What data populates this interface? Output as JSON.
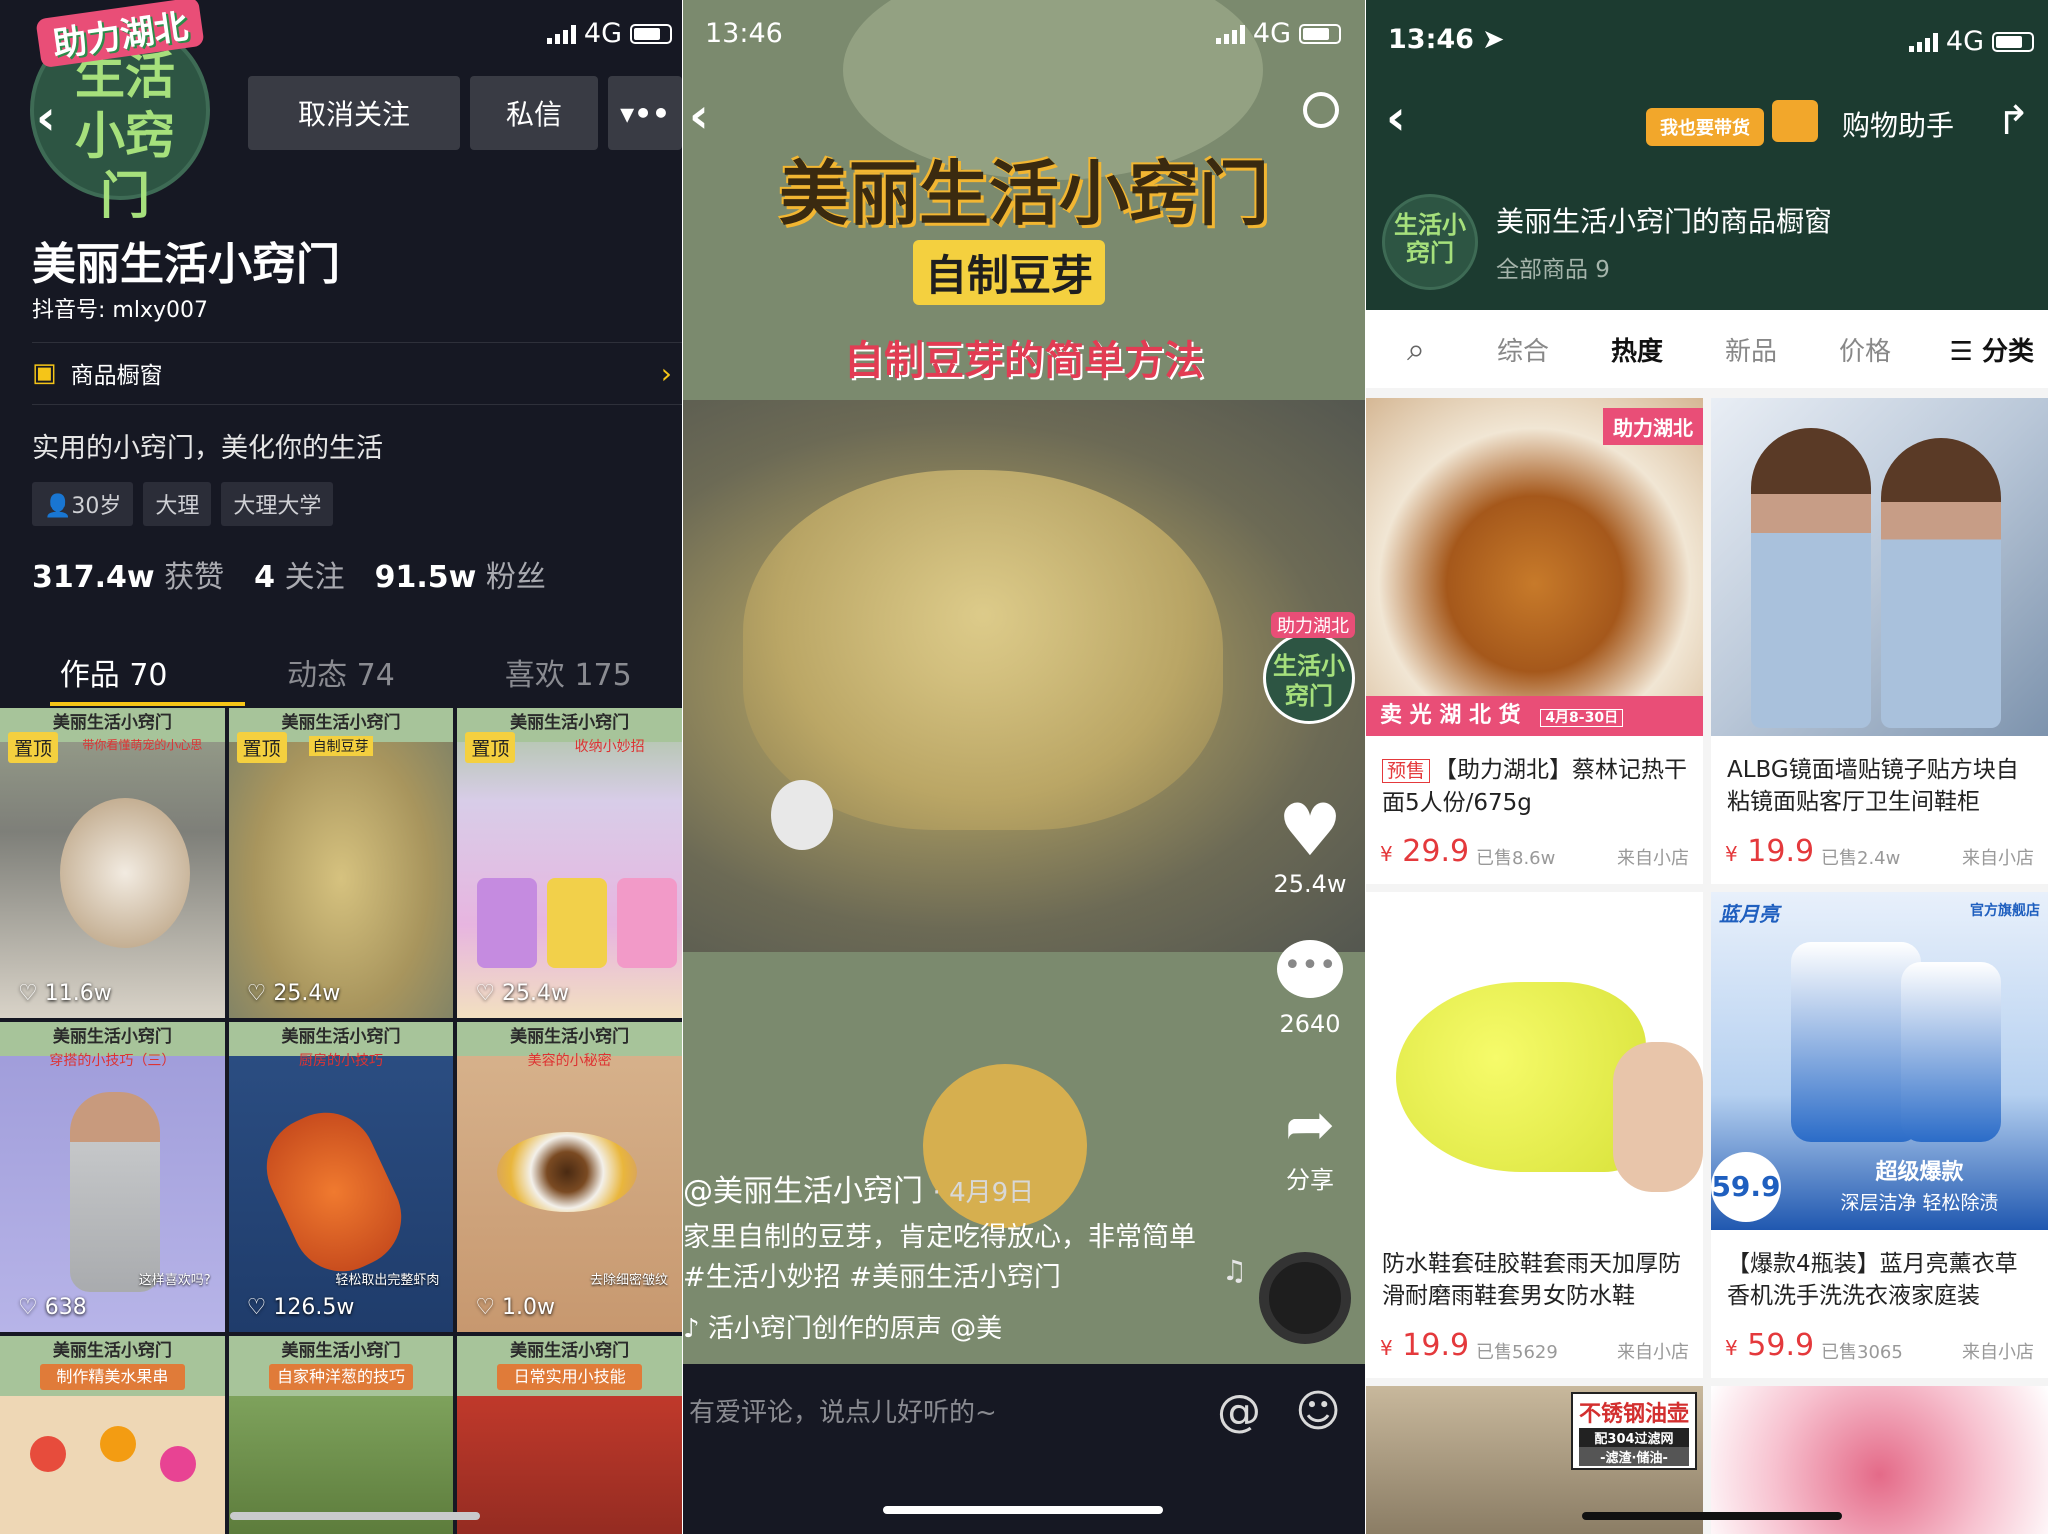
{
  "status": {
    "p1_network": "4G",
    "p2_time": "13:46",
    "p2_network": "4G",
    "p3_time": "13:46",
    "p3_network": "4G"
  },
  "profile": {
    "avatar_badge": "助力湖北",
    "avatar_text": "生活小窍门",
    "unfollow_label": "取消关注",
    "message_label": "私信",
    "more_icon": "more-icon",
    "name": "美丽生活小窍门",
    "douyin_id": "抖音号: mlxy007",
    "shop_label": "商品橱窗",
    "bio": "实用的小窍门，美化你的生活",
    "tags": [
      "30岁",
      "大理",
      "大理大学"
    ],
    "stats": {
      "likes_num": "317.4w",
      "likes_label": "获赞",
      "following_num": "4",
      "following_label": "关注",
      "fans_num": "91.5w",
      "fans_label": "粉丝"
    },
    "tabs": [
      "作品 70",
      "动态 74",
      "喜欢 175"
    ],
    "videos": [
      {
        "header": "美丽生活小窍门",
        "pin": "置顶",
        "sub": "带你看懂萌宠的小心思",
        "likes": "11.6w",
        "caption": ""
      },
      {
        "header": "美丽生活小窍门",
        "pin": "置顶",
        "sub": "自制豆芽",
        "likes": "25.4w",
        "caption": ""
      },
      {
        "header": "美丽生活小窍门",
        "pin": "置顶",
        "sub": "收纳小妙招",
        "likes": "25.4w",
        "caption": ""
      },
      {
        "header": "美丽生活小窍门",
        "pin": "",
        "sub": "穿搭的小技巧（三）",
        "likes": "638",
        "caption": "这样喜欢吗?"
      },
      {
        "header": "美丽生活小窍门",
        "pin": "",
        "sub": "厨房的小技巧",
        "likes": "126.5w",
        "caption": "轻松取出完整虾肉"
      },
      {
        "header": "美丽生活小窍门",
        "pin": "",
        "sub": "美容的小秘密",
        "likes": "1.0w",
        "caption": "去除细密皱纹"
      },
      {
        "header": "美丽生活小窍门",
        "banner": "制作精美水果串"
      },
      {
        "header": "美丽生活小窍门",
        "banner": "自家种洋葱的技巧"
      },
      {
        "header": "美丽生活小窍门",
        "banner": "日常实用小技能"
      }
    ]
  },
  "video": {
    "title": "美丽生活小窍门",
    "subtitle": "自制豆芽",
    "subtitle2": "自制豆芽的简单方法",
    "author_badge": "助力湖北",
    "author_avatar": "生活小窍门",
    "like_count": "25.4w",
    "comment_count": "2640",
    "share_label": "分享",
    "author": "@美丽生活小窍门",
    "date": "· 4月9日",
    "caption": "家里自制的豆芽，肯定吃得放心，非常简单 #生活小妙招  #美丽生活小窍门",
    "music": "♪ 活小窍门创作的原声    @美",
    "comment_placeholder": "有爱评论，说点儿好听的~",
    "at_icon": "@",
    "emoji_icon": "☺"
  },
  "shop": {
    "help_badge": "我也要带货",
    "assistant": "购物助手",
    "avatar_text": "生活小窍门",
    "title": "美丽生活小窍门的商品橱窗",
    "count": "全部商品 9",
    "sort": [
      "综合",
      "热度",
      "新品",
      "价格"
    ],
    "category": "☰ 分类",
    "products": [
      {
        "presale": "预售",
        "title": "【助力湖北】蔡林记热干面5人份/675g",
        "price": "29.9",
        "sold": "已售8.6w",
        "source": "来自小店",
        "img_label": "助力湖北",
        "img_foot": "卖 光 湖 北 货",
        "img_date": "4月8-30日"
      },
      {
        "presale": "",
        "title": "ALBG镜面墙贴镜子贴方块自粘镜面贴客厅卫生间鞋柜",
        "price": "19.9",
        "sold": "已售2.4w",
        "source": "来自小店"
      },
      {
        "presale": "",
        "title": "防水鞋套硅胶鞋套雨天加厚防滑耐磨雨鞋套男女防水鞋",
        "price": "19.9",
        "sold": "已售5629",
        "source": "来自小店"
      },
      {
        "presale": "",
        "title": "【爆款4瓶装】蓝月亮薰衣草香机洗手洗洗衣液家庭装",
        "price": "59.9",
        "sold": "已售3065",
        "source": "来自小店",
        "img_brand": "蓝月亮",
        "img_store": "官方旗舰店",
        "img_price": "59.9",
        "img_promo": "超级爆款",
        "img_slogan": "深层洁净 轻松除渍"
      },
      {
        "img_label": "不锈钢油壶",
        "img_sub": "配304过滤网",
        "img_sub2": "-滤渣·储油-"
      },
      {}
    ]
  }
}
